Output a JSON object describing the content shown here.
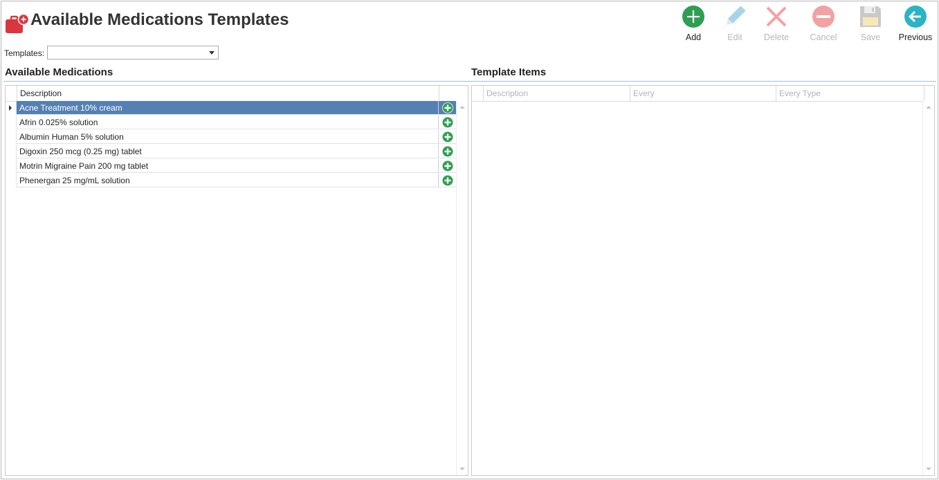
{
  "page": {
    "title": "Available Medications Templates",
    "icon": "medical-kit-icon"
  },
  "toolbar": {
    "add_label": "Add",
    "edit_label": "Edit",
    "delete_label": "Delete",
    "cancel_label": "Cancel",
    "save_label": "Save",
    "previous_label": "Previous"
  },
  "templates": {
    "label": "Templates:",
    "value": ""
  },
  "available_medications": {
    "heading": "Available Medications",
    "columns": [
      "Description"
    ],
    "rows": [
      {
        "description": "Acne Treatment 10% cream",
        "selected": true
      },
      {
        "description": "Afrin 0.025% solution",
        "selected": false
      },
      {
        "description": "Albumin Human 5% solution",
        "selected": false
      },
      {
        "description": "Digoxin 250 mcg (0.25 mg) tablet",
        "selected": false
      },
      {
        "description": "Motrin Migraine Pain 200 mg tablet",
        "selected": false
      },
      {
        "description": "Phenergan 25 mg/mL solution",
        "selected": false
      }
    ]
  },
  "template_items": {
    "heading": "Template Items",
    "columns": [
      "Description",
      "Every",
      "Every Type"
    ],
    "rows": []
  },
  "colors": {
    "accent_green": "#2e9e52",
    "selected_row": "#5580b3",
    "previous_teal": "#2bb3c6",
    "title_icon_red": "#d9363e"
  }
}
